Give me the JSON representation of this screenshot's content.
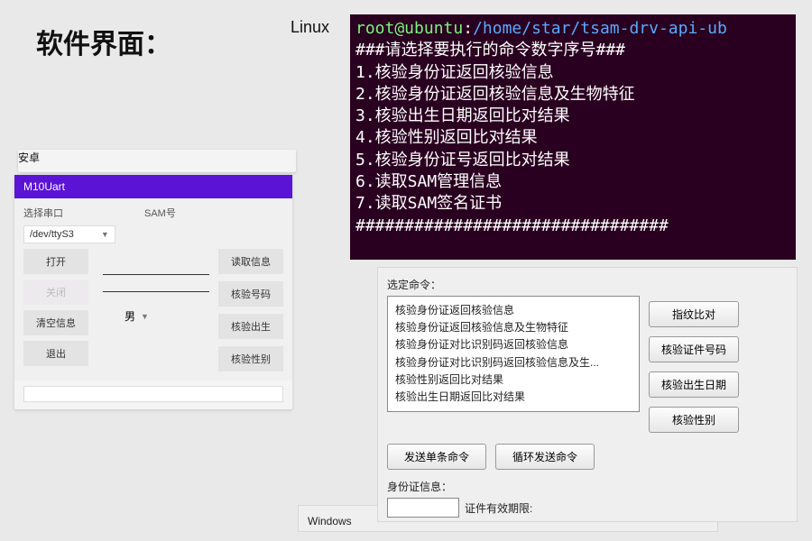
{
  "page_title": "软件界面：",
  "labels": {
    "linux": "Linux",
    "android": "安卓",
    "windows": "Windows"
  },
  "linux_term": {
    "prompt_user": "root@ubuntu",
    "prompt_sep": ":",
    "prompt_path": "/home/star/tsam-drv-api-ub",
    "header": "###请选择要执行的命令数字序号###",
    "items": [
      "1.核验身份证返回核验信息",
      "2.核验身份证返回核验信息及生物特征",
      "3.核验出生日期返回比对结果",
      "4.核验性别返回比对结果",
      "5.核验身份证号返回比对结果",
      "6.读取SAM管理信息",
      "7.读取SAM签名证书"
    ],
    "footer": "################################"
  },
  "android": {
    "title": "M10Uart",
    "port_label": "选择串口",
    "sam_label": "SAM号",
    "port_value": "/dev/ttyS3",
    "gender_value": "男",
    "left_buttons": [
      "打开",
      "关闭",
      "清空信息",
      "退出"
    ],
    "right_buttons": [
      "读取信息",
      "核验号码",
      "核验出生",
      "核验性别"
    ]
  },
  "windows": {
    "select_cmd_label": "选定命令：",
    "list_items": [
      "核验身份证返回核验信息",
      "核验身份证返回核验信息及生物特征",
      "核验身份证对比识别码返回核验信息",
      "核验身份证对比识别码返回核验信息及生...",
      "核验性别返回比对结果",
      "核验出生日期返回比对结果"
    ],
    "right_buttons": [
      "指纹比对",
      "核验证件号码",
      "核验出生日期",
      "核验性别"
    ],
    "row_buttons": [
      "发送单条命令",
      "循环发送命令"
    ],
    "id_info_label": "身份证信息：",
    "id_expire_label": "证件有效期限:"
  }
}
